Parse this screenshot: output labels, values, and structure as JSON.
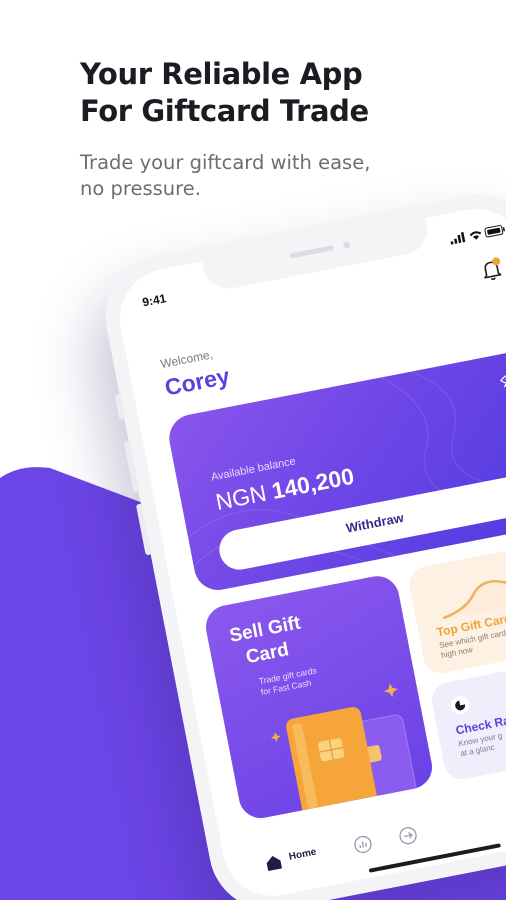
{
  "headline": {
    "line1": "Your Reliable App",
    "line2": "For Giftcard Trade"
  },
  "subheadline": {
    "line1": "Trade your giftcard with ease,",
    "line2": "no pressure."
  },
  "colors": {
    "brand_purple": "#6c45e6",
    "text_dark": "#1b1b22",
    "accent_orange": "#f0a23c"
  },
  "phone": {
    "status_bar": {
      "time": "9:41"
    },
    "header": {
      "welcome": "Welcome,",
      "user_name": "Corey",
      "notification_icon": "bell-icon"
    },
    "balance_card": {
      "label": "Available balance",
      "currency": "NGN",
      "amount": "140,200",
      "visibility_icon": "eye-off-icon",
      "withdraw_label": "Withdraw"
    },
    "sell_card": {
      "title_line1": "Sell Gift",
      "title_line2": "Card",
      "desc_line1": "Trade gift cards",
      "desc_line2": "for Fast Cash"
    },
    "top_card": {
      "title": "Top Gift Cards",
      "desc_line1": "See which gift cards are",
      "desc_line2": "high now"
    },
    "check_card": {
      "title": "Check Ra",
      "desc_line1": "Know your g",
      "desc_line2": "at a glanc"
    },
    "tab_bar": {
      "home_label": "Home",
      "home_icon": "home-icon",
      "second_icon": "stats-icon",
      "third_icon": "wallet-icon"
    }
  }
}
